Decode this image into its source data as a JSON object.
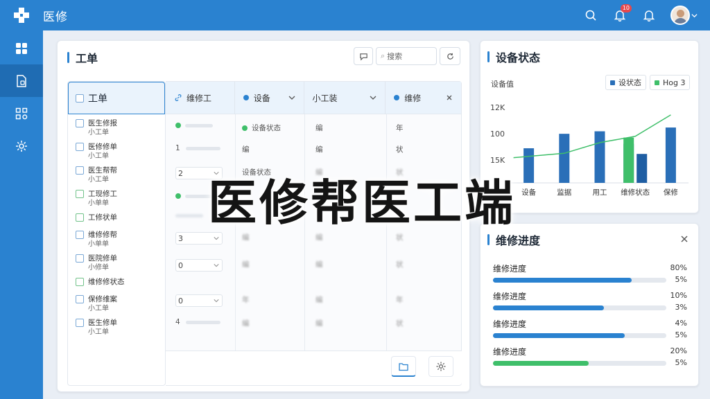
{
  "app": {
    "title": "医修",
    "notif_count": "10"
  },
  "colors": {
    "primary": "#2a82d0",
    "accent_green": "#3fbf6a",
    "track": "#e4e8ee"
  },
  "sidebar": {
    "items": [
      {
        "icon": "grid-icon",
        "active": false
      },
      {
        "icon": "document-icon",
        "active": true
      },
      {
        "icon": "apps-icon",
        "active": false
      },
      {
        "icon": "settings-icon",
        "active": false
      }
    ]
  },
  "work_order": {
    "title": "工单",
    "search_placeholder": "搜索",
    "list_header": "工单",
    "list_items": [
      {
        "line1": "医生修报",
        "line2": "小工单",
        "green": false
      },
      {
        "line1": "医修修单",
        "line2": "小工单",
        "green": false
      },
      {
        "line1": "医生帮帮",
        "line2": "小工单",
        "green": false
      },
      {
        "line1": "工现修工",
        "line2": "小单单",
        "green": true
      },
      {
        "line1": "工修状单",
        "line2": "",
        "green": true
      },
      {
        "line1": "维修修帮",
        "line2": "小单单",
        "green": false
      },
      {
        "line1": "医院修单",
        "line2": "小修单",
        "green": false
      },
      {
        "line1": "维修修状态",
        "line2": "",
        "green": true
      },
      {
        "line1": "保修维案",
        "line2": "小工单",
        "green": false
      },
      {
        "line1": "医生修单",
        "line2": "小工单",
        "green": false
      }
    ],
    "columns": [
      "维修工",
      "设备",
      "小工装",
      "维修"
    ],
    "rows": [
      {
        "c1": "",
        "c2": "设备状态",
        "c3": "编",
        "c4": "年"
      },
      {
        "c1": "1",
        "c2": "编",
        "c3": "编",
        "c4": "状"
      },
      {
        "c1": "2",
        "c2": "设备状态",
        "c3": "编",
        "c4": "状"
      },
      {
        "c1": "",
        "c2": "",
        "c3": "",
        "c4": ""
      },
      {
        "c1": "",
        "c2": "",
        "c3": "",
        "c4": ""
      },
      {
        "c1": "3",
        "c2": "编",
        "c3": "编",
        "c4": "状"
      },
      {
        "c1": "0",
        "c2": "编",
        "c3": "编",
        "c4": "状"
      },
      {
        "c1": "0",
        "c2": "年",
        "c3": "编",
        "c4": "年"
      },
      {
        "c1": "4",
        "c2": "编",
        "c3": "编",
        "c4": "状"
      }
    ]
  },
  "device_status": {
    "title": "设备状态",
    "subtitle": "设备值",
    "legend": [
      {
        "label": "设状态",
        "color": "#2a6fb8"
      },
      {
        "label": "Hog 3",
        "color": "#3fbf6a"
      }
    ]
  },
  "chart_data": {
    "type": "bar",
    "categories": [
      "设备",
      "监据",
      "用工",
      "维修状态",
      "保修"
    ],
    "y_tick_labels": [
      "12K",
      "100",
      "15K"
    ],
    "series": [
      {
        "name": "设状态",
        "values": [
          55,
          78,
          82,
          62,
          88
        ],
        "color": "#2a6fb8"
      },
      {
        "name": "Hog 3",
        "values": [
          null,
          null,
          null,
          72,
          null
        ],
        "color": "#3fbf6a"
      }
    ],
    "extra_bar": {
      "category": "维修状态",
      "value": 46,
      "color": "#1f5ea3"
    },
    "trend_line": [
      40,
      47,
      64,
      74,
      108
    ],
    "ylim": [
      0,
      120
    ]
  },
  "progress": {
    "title": "维修进度",
    "items": [
      {
        "label": "维修进度",
        "pct_top": "80%",
        "pct_bottom": "5%",
        "value": 0.8,
        "color": "#2a82d0"
      },
      {
        "label": "维修进度",
        "pct_top": "10%",
        "pct_bottom": "3%",
        "value": 0.64,
        "color": "#2a82d0"
      },
      {
        "label": "维修进度",
        "pct_top": "4%",
        "pct_bottom": "5%",
        "value": 0.76,
        "color": "#2a82d0"
      },
      {
        "label": "维修进度",
        "pct_top": "20%",
        "pct_bottom": "5%",
        "value": 0.55,
        "color": "#3fbf6a"
      }
    ]
  },
  "headline": "医修帮医工端"
}
